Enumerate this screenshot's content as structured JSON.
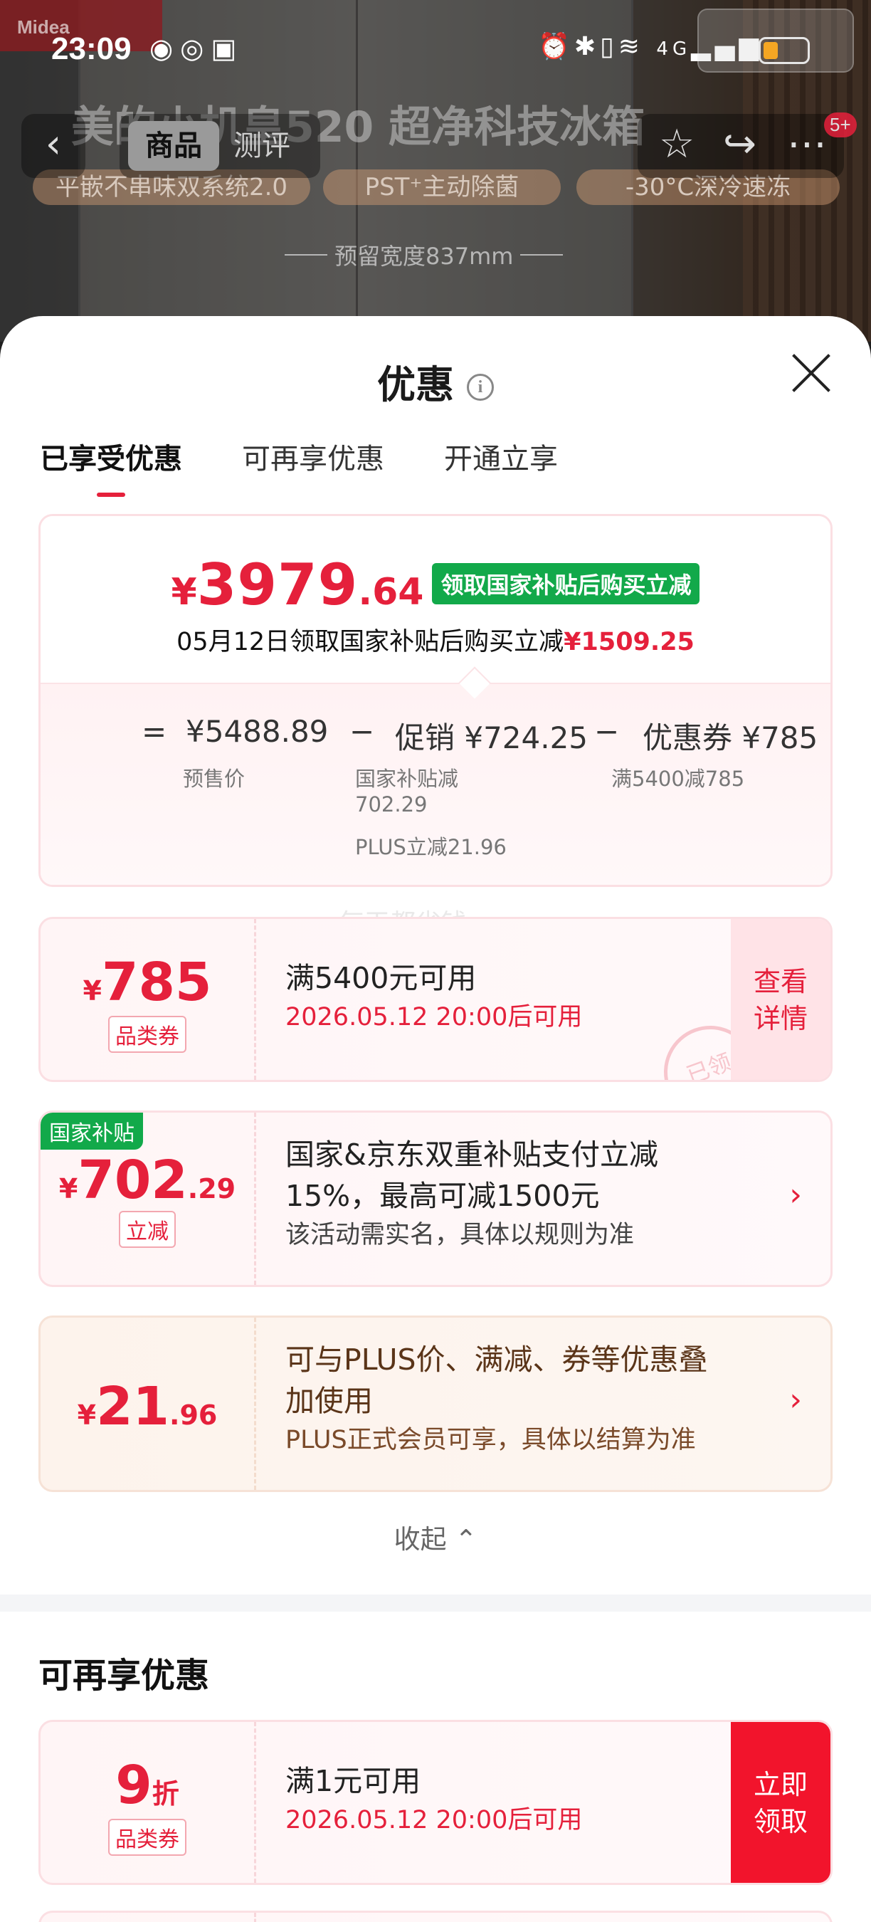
{
  "status_bar": {
    "time": "23:09",
    "network": "4G"
  },
  "background": {
    "brand": "Midea",
    "title": "美的小机皇520 超净科技冰箱",
    "features": [
      "平嵌不串味双系统2.0",
      "PST⁺主动除菌",
      "-30°C深冷速冻"
    ],
    "width_label": "预留宽度837mm"
  },
  "nav": {
    "back_icon": "‹",
    "tabs": [
      {
        "label": "商品",
        "active": true
      },
      {
        "label": "测评",
        "active": false
      }
    ],
    "badge": "5+"
  },
  "sheet": {
    "title": "优惠",
    "tabs": [
      {
        "label": "已享受优惠",
        "active": true
      },
      {
        "label": "可再享优惠",
        "active": false
      },
      {
        "label": "开通立享",
        "active": false
      }
    ],
    "summary": {
      "currency": "¥",
      "final_price_int": "3979",
      "final_price_dec": ".64",
      "tag": "领取国家补贴后购买立减",
      "note": "05月12日领取国家补贴后购买立减",
      "note_amount": "¥1509.25",
      "formula": {
        "eq": "=",
        "minus": "−",
        "presale_price": "¥5488.89",
        "presale_label": "预售价",
        "promo": "促销 ¥724.25",
        "promo_sub1": "国家补贴减",
        "promo_sub1_value": "702.29",
        "promo_sub2": "PLUS立减21.96",
        "coupon": "优惠券 ¥785",
        "coupon_sub": "满5400减785"
      }
    },
    "watermark": "每天都省钱",
    "coupons": [
      {
        "sym": "¥",
        "amount": "785",
        "dec": "",
        "tag": "品类券",
        "main": "满5400元可用",
        "sub": "2026.05.12 20:00后可用",
        "action": "查看详情",
        "stamp": "已领"
      },
      {
        "corner": "国家补贴",
        "sym": "¥",
        "amount": "702",
        "dec": ".29",
        "tag": "立减",
        "main1": "国家&京东双重补贴支付立减",
        "main2": "15%，最高可减1500元",
        "sub": "该活动需实名，具体以规则为准",
        "arrow": "›"
      },
      {
        "sym": "¥",
        "amount": "21",
        "dec": ".96",
        "main1": "可与PLUS价、满减、券等优惠叠",
        "main2": "加使用",
        "sub": "PLUS正式会员可享，具体以结算为准",
        "arrow": "›"
      }
    ],
    "collapse_label": "收起 ⌃",
    "more_section_title": "可再享优惠",
    "more_coupons": [
      {
        "amount": "9",
        "unit": "折",
        "tag": "品类券",
        "main": "满1元可用",
        "sub": "2026.05.12 20:00后可用",
        "action": "立即领取"
      }
    ]
  },
  "colors": {
    "accent_red": "#e5203b",
    "green": "#12a94a",
    "plus_brown": "#7a4a2a"
  }
}
